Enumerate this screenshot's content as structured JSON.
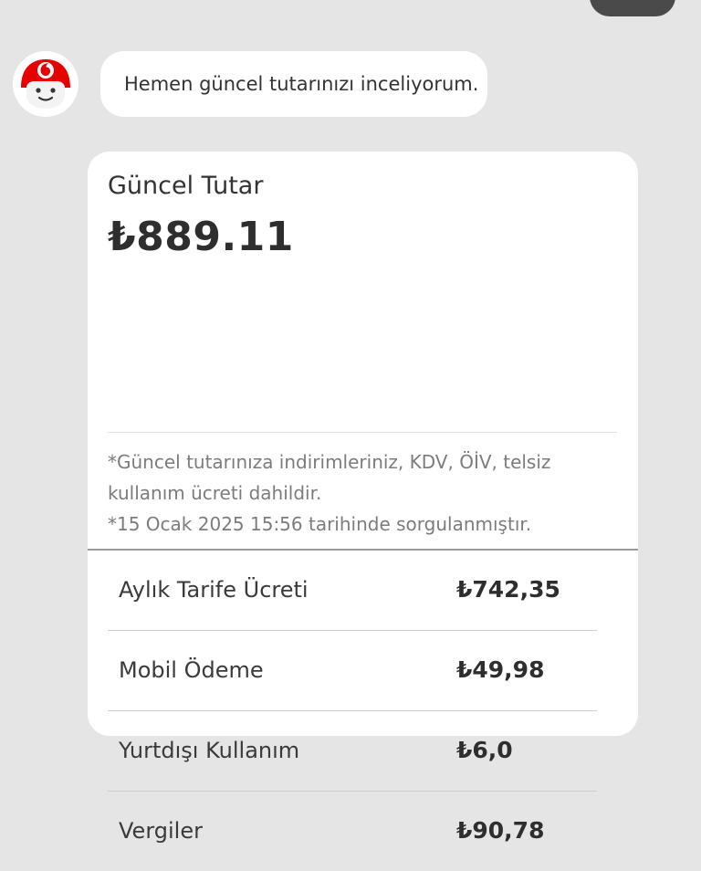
{
  "chat": {
    "bot_message": "Hemen güncel tutarınızı inceliyorum."
  },
  "card": {
    "title": "Güncel Tutar",
    "amount": "₺889.11",
    "notes": [
      "*Güncel tutarınıza indirimleriniz, KDV, ÖİV, telsiz",
      "kullanım ücreti dahildir.",
      "*15 Ocak 2025 15:56 tarihinde sorgulanmıştır."
    ],
    "rows": [
      {
        "label": "Aylık Tarife Ücreti",
        "value": "₺742,35"
      },
      {
        "label": "Mobil Ödeme",
        "value": "₺49,98"
      },
      {
        "label": "Yurtdışı Kullanım",
        "value": "₺6,0"
      },
      {
        "label": "Vergiler",
        "value": "₺90,78"
      }
    ]
  },
  "colors": {
    "background": "#e5e5e5",
    "brand_red": "#e60000",
    "user_bubble": "#4a4a4a"
  },
  "icons": {
    "avatar": "vodafone-mascot-icon"
  }
}
